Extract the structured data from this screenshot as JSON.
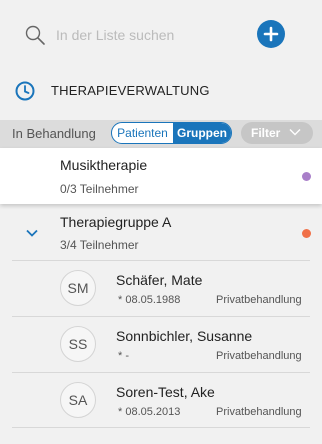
{
  "search": {
    "placeholder": "In der Liste suchen"
  },
  "section": {
    "title": "THERAPIEVERWALTUNG"
  },
  "filter_bar": {
    "label": "In Behandlung",
    "segments": {
      "patienten": "Patienten",
      "gruppen": "Gruppen"
    },
    "selected_segment": "Gruppen",
    "filter_label": "Filter"
  },
  "groups": [
    {
      "name": "Musiktherapie",
      "participants": "0/3 Teilnehmer",
      "dot_color": "#a97fc9"
    },
    {
      "name": "Therapiegruppe A",
      "participants": "3/4 Teilnehmer",
      "dot_color": "#f07048"
    }
  ],
  "patients": [
    {
      "initials": "SM",
      "name": "Schäfer, Mate",
      "birth": "* 08.05.1988",
      "type": "Privatbehandlung"
    },
    {
      "initials": "SS",
      "name": "Sonnbichler, Susanne",
      "birth": "* -",
      "type": "Privatbehandlung"
    },
    {
      "initials": "SA",
      "name": "Soren-Test, Ake",
      "birth": "* 08.05.2013",
      "type": "Privatbehandlung"
    }
  ],
  "colors": {
    "accent": "#1a75bb"
  }
}
